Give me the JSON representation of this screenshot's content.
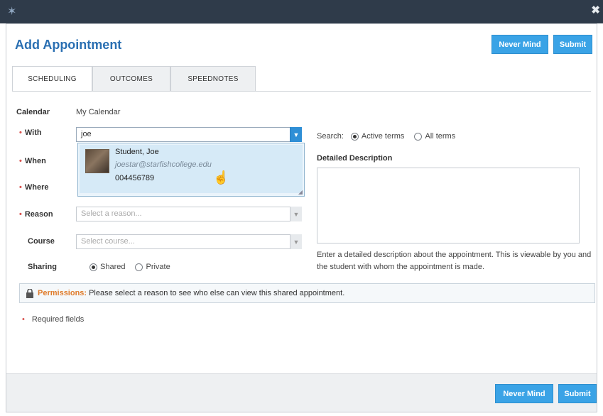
{
  "window": {
    "close_glyph": "✖"
  },
  "dialog": {
    "title": "Add Appointment"
  },
  "buttons": {
    "never_mind": "Never Mind",
    "submit": "Submit"
  },
  "tabs": [
    {
      "label": "SCHEDULING",
      "active": true
    },
    {
      "label": "OUTCOMES",
      "active": false
    },
    {
      "label": "SPEEDNOTES",
      "active": false
    }
  ],
  "form": {
    "calendar_label": "Calendar",
    "calendar_value": "My Calendar",
    "with_label": "With",
    "with_value": "joe",
    "when_label": "When",
    "where_label": "Where",
    "reason_label": "Reason",
    "reason_placeholder": "Select a reason...",
    "course_label": "Course",
    "course_placeholder": "Select course...",
    "sharing_label": "Sharing",
    "sharing_options": [
      "Shared",
      "Private"
    ],
    "sharing_selected": "Shared"
  },
  "dropdown": {
    "results": [
      {
        "name": "Student, Joe",
        "email": "joestar@starfishcollege.edu",
        "id": "004456789"
      }
    ]
  },
  "search": {
    "label": "Search:",
    "options": [
      "Active terms",
      "All terms"
    ],
    "selected": "Active terms"
  },
  "description": {
    "label": "Detailed Description",
    "help_text": "Enter a detailed description about the appointment. This is viewable by you and the student with whom the appointment is made."
  },
  "permissions": {
    "title": "Permissions:",
    "message": "Please select a reason to see who else can view this shared appointment."
  },
  "required_note": "Required fields",
  "icons": {
    "logo": "starfish-logo-icon",
    "lock": "lock-icon",
    "dropdown": "chevron-down-icon",
    "cursor": "hand-pointer-icon"
  },
  "colors": {
    "title_blue": "#2a6fb2",
    "button_blue": "#3aa3e6",
    "required_red": "#d9534f",
    "permissions_orange": "#e07b2a",
    "titlebar": "#2f3b4a"
  }
}
